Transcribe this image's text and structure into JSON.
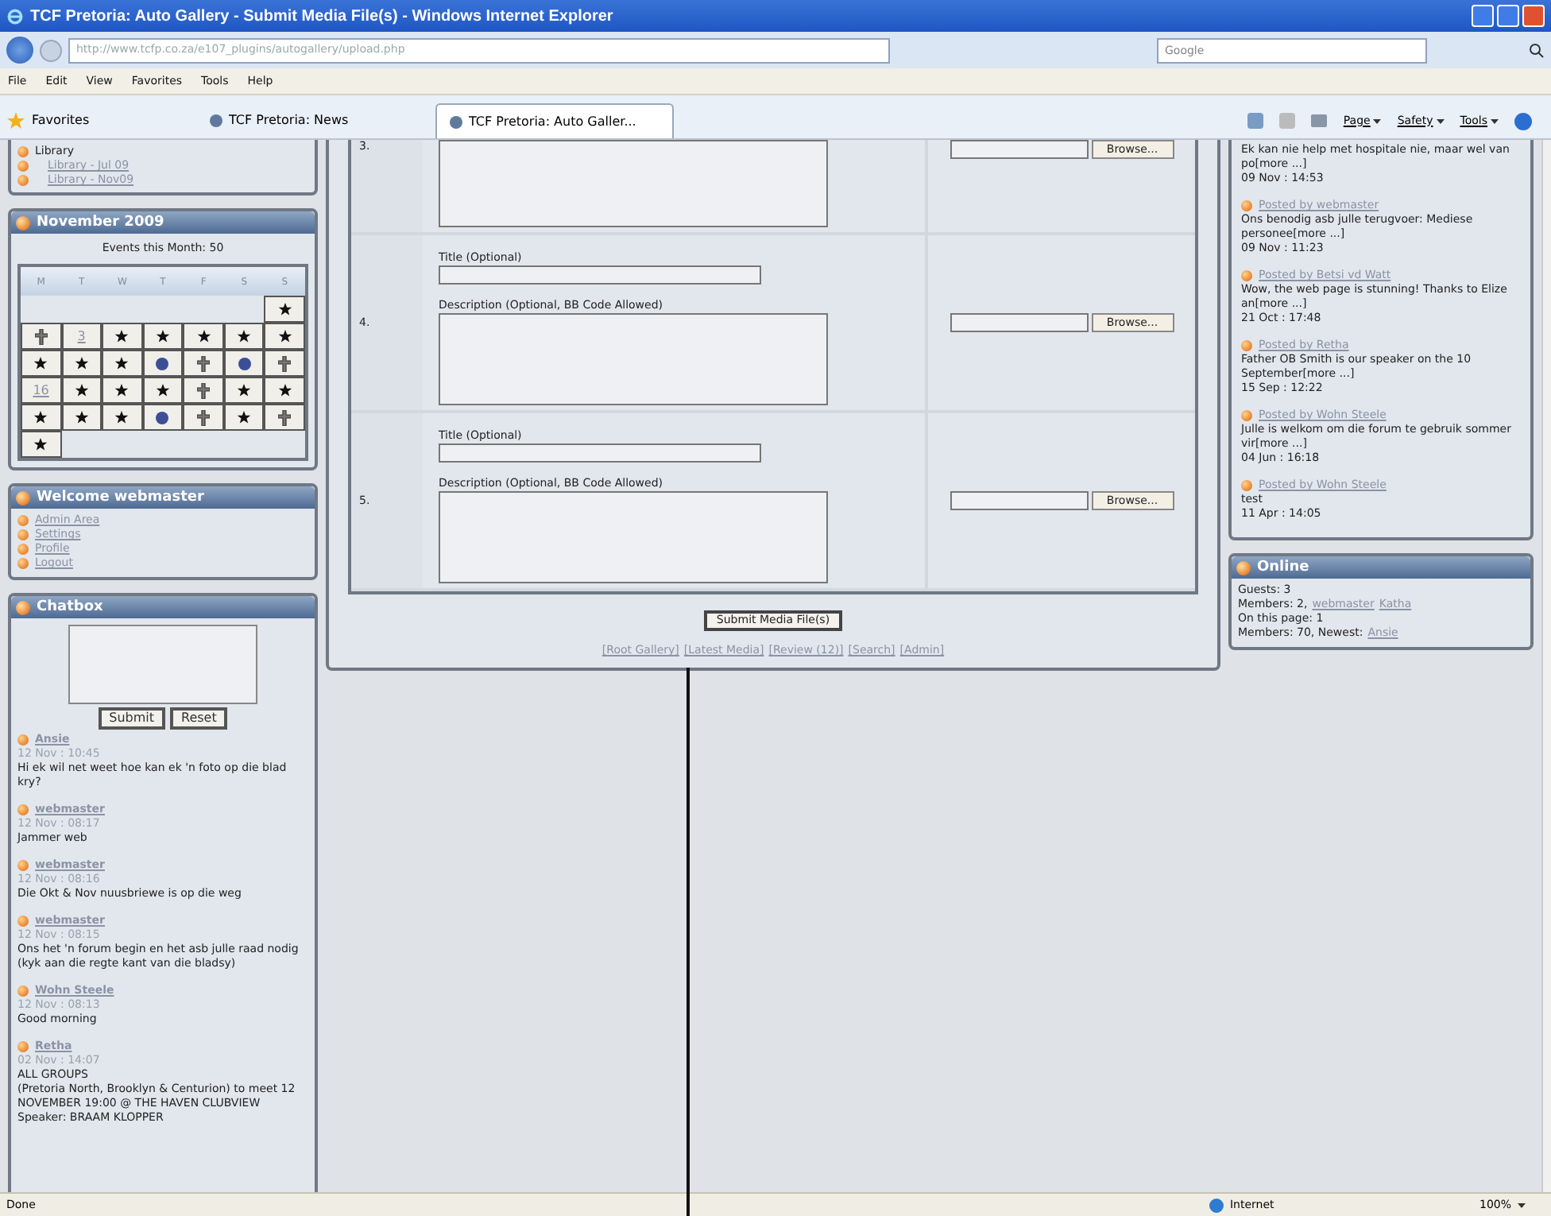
{
  "window": {
    "title": "TCF Pretoria: Auto Gallery - Submit Media File(s) - Windows Internet Explorer"
  },
  "address_bar": {
    "url": "http://www.tcfp.co.za/e107_plugins/autogallery/upload.php",
    "search_placeholder": "Google"
  },
  "menu": [
    "File",
    "Edit",
    "View",
    "Favorites",
    "Tools",
    "Help"
  ],
  "favorites_label": "Favorites",
  "tabs": [
    {
      "label": "TCF Pretoria: News",
      "selected": false
    },
    {
      "label": "TCF Pretoria: Auto Galler...",
      "selected": true
    }
  ],
  "command_bar": [
    "Page",
    "Safety",
    "Tools"
  ],
  "library": {
    "title": "Library",
    "links": [
      "Library - Jul 09",
      "Library - Nov09"
    ]
  },
  "calendar": {
    "title": "November 2009",
    "events": "Events this Month: 50",
    "days": [
      "M",
      "T",
      "W",
      "T",
      "F",
      "S",
      "S"
    ],
    "weeks": [
      [
        {
          "kind": "blank"
        },
        {
          "kind": "blank"
        },
        {
          "kind": "blank"
        },
        {
          "kind": "blank"
        },
        {
          "kind": "blank"
        },
        {
          "kind": "blank"
        },
        {
          "kind": "star"
        }
      ],
      [
        {
          "kind": "cross"
        },
        {
          "kind": "date",
          "text": "3"
        },
        {
          "kind": "star"
        },
        {
          "kind": "star"
        },
        {
          "kind": "star"
        },
        {
          "kind": "star"
        },
        {
          "kind": "star"
        }
      ],
      [
        {
          "kind": "star"
        },
        {
          "kind": "star"
        },
        {
          "kind": "star"
        },
        {
          "kind": "dot"
        },
        {
          "kind": "cross"
        },
        {
          "kind": "dot"
        },
        {
          "kind": "cross"
        }
      ],
      [
        {
          "kind": "date",
          "text": "16"
        },
        {
          "kind": "star"
        },
        {
          "kind": "star"
        },
        {
          "kind": "star"
        },
        {
          "kind": "cross"
        },
        {
          "kind": "star"
        },
        {
          "kind": "star"
        }
      ],
      [
        {
          "kind": "star"
        },
        {
          "kind": "star"
        },
        {
          "kind": "star"
        },
        {
          "kind": "dot"
        },
        {
          "kind": "cross"
        },
        {
          "kind": "star"
        },
        {
          "kind": "cross"
        }
      ],
      [
        {
          "kind": "star"
        },
        {
          "kind": "blank"
        },
        {
          "kind": "blank"
        },
        {
          "kind": "blank"
        },
        {
          "kind": "blank"
        },
        {
          "kind": "blank"
        },
        {
          "kind": "blank"
        }
      ]
    ]
  },
  "welcome": {
    "title": "Welcome webmaster",
    "links": [
      "Admin Area",
      "Settings",
      "Profile",
      "Logout"
    ]
  },
  "chatbox": {
    "title": "Chatbox",
    "buttons": [
      "Submit",
      "Reset"
    ],
    "messages": [
      {
        "author": "Ansie",
        "time": "12 Nov : 10:45",
        "text": "Hi ek wil net weet hoe kan ek 'n foto op die blad kry?"
      },
      {
        "author": "webmaster",
        "time": "12 Nov : 08:17",
        "text": "Jammer web"
      },
      {
        "author": "webmaster",
        "time": "12 Nov : 08:16",
        "text": "Die Okt & Nov nuusbriewe is op die weg"
      },
      {
        "author": "webmaster",
        "time": "12 Nov : 08:15",
        "text": "Ons het 'n forum begin en het asb julle raad nodig (kyk aan die regte kant van die bladsy)"
      },
      {
        "author": "Wohn Steele",
        "time": "12 Nov : 08:13",
        "text": "Good morning"
      },
      {
        "author": "Retha",
        "time": "02 Nov : 14:07",
        "text": "ALL GROUPS\n(Pretoria North, Brooklyn & Centurion) to meet 12 NOVEMBER 19:00 @ THE HAVEN CLUBVIEW\nSpeaker: BRAAM KLOPPER"
      }
    ]
  },
  "upload_rows": [
    {
      "kind": "partial",
      "number": "3.",
      "browse": "Browse..."
    },
    {
      "kind": "full",
      "number": "4.",
      "title_label": "Title (Optional)",
      "description_label": "Description (Optional, BB Code Allowed)",
      "browse": "Browse..."
    },
    {
      "kind": "full",
      "number": "5.",
      "title_label": "Title (Optional)",
      "description_label": "Description (Optional, BB Code Allowed)",
      "browse": "Browse..."
    }
  ],
  "submit_button": "Submit Media File(s)",
  "footer_links": [
    "[Root Gallery]",
    "[Latest Media]",
    "[Review (12)]",
    "[Search]",
    "[Admin]"
  ],
  "news": [
    {
      "text": "Ek kan nie help met hospitale nie, maar wel van po",
      "more": "[more ...]",
      "date": "09 Nov : 14:53"
    },
    {
      "posted_by": "Posted by webmaster",
      "text": "Ons benodig asb julle terugvoer: Mediese personee",
      "more": "[more ...]",
      "date": "09 Nov : 11:23"
    },
    {
      "posted_by": "Posted by Betsi vd Watt",
      "text": "Wow, the web page is stunning! Thanks to Elize an",
      "more": "[more ...]",
      "date": "21 Oct : 17:48"
    },
    {
      "posted_by": "Posted by Retha",
      "text": "Father OB Smith is our speaker on the 10 September",
      "more": "[more ...]",
      "date": "15 Sep : 12:22"
    },
    {
      "posted_by": "Posted by Wohn Steele",
      "text": "Julle is welkom om die forum te gebruik sommer vir",
      "more": "[more ...]",
      "date": "04 Jun : 16:18"
    },
    {
      "posted_by": "Posted by Wohn Steele",
      "text": "test",
      "date": "11 Apr : 14:05"
    }
  ],
  "online": {
    "title": "Online",
    "lines": [
      {
        "text": "Guests: 3"
      },
      {
        "text": "Members: 2,",
        "links": [
          "webmaster",
          "Katha"
        ]
      },
      {
        "text": "On this page: 1"
      },
      {
        "text": "Members: 70, Newest:",
        "links": [
          "Ansie"
        ]
      }
    ]
  },
  "status_bar": {
    "text": "Done",
    "zone": "Internet",
    "zoom": "100%"
  }
}
